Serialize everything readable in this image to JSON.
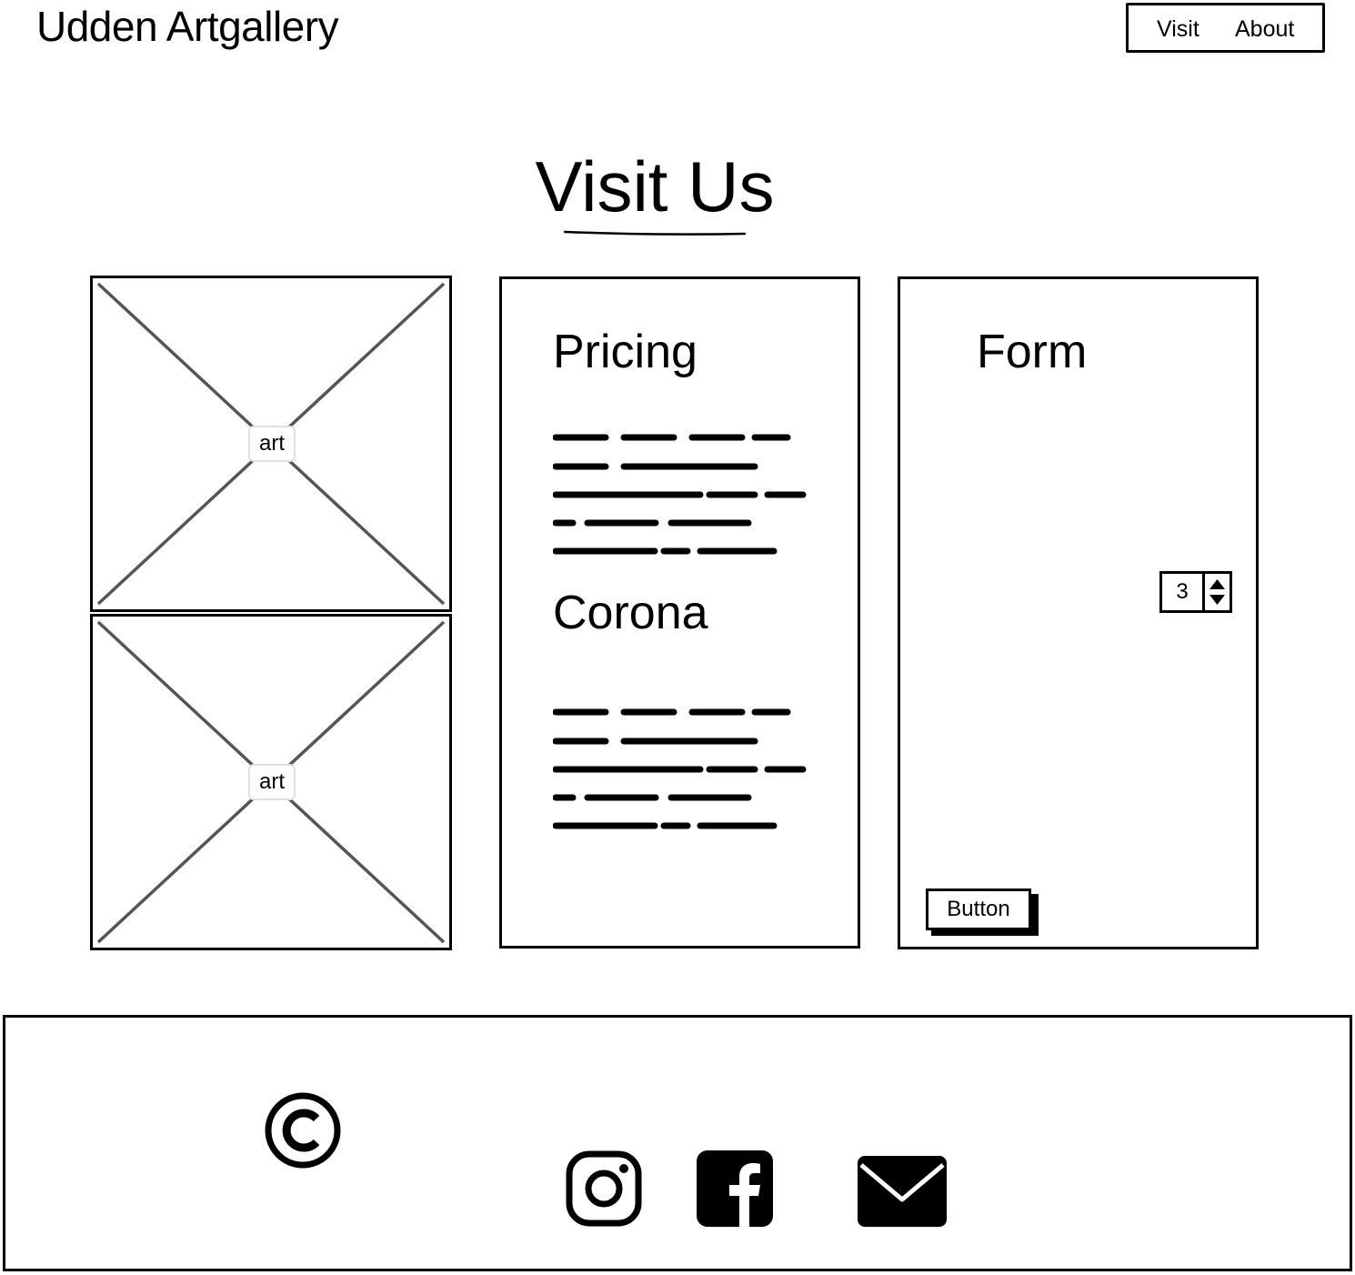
{
  "header": {
    "site_title": "Udden Artgallery",
    "nav": [
      {
        "label": "Visit"
      },
      {
        "label": "About"
      }
    ]
  },
  "page": {
    "title": "Visit Us"
  },
  "gallery": {
    "images": [
      {
        "label": "art"
      },
      {
        "label": "art"
      }
    ]
  },
  "info": {
    "pricing_heading": "Pricing",
    "corona_heading": "Corona"
  },
  "form": {
    "heading": "Form",
    "stepper_value": "3",
    "button_label": "Button"
  },
  "footer": {
    "icons": [
      "copyright-icon",
      "instagram-icon",
      "facebook-icon",
      "mail-icon"
    ]
  }
}
